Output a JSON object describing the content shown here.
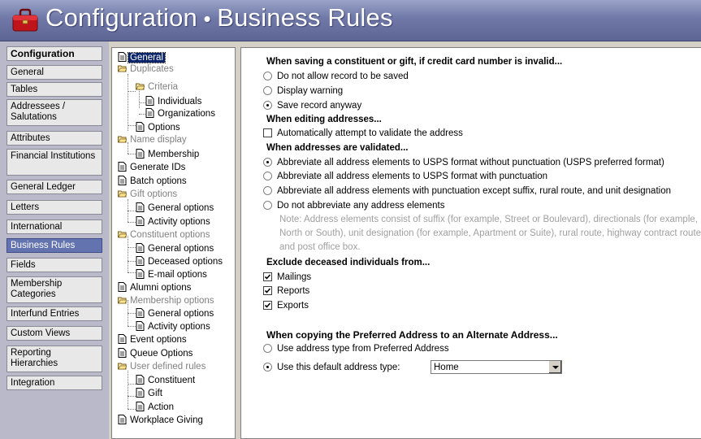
{
  "title": {
    "prefix": "Configuration",
    "separator": "•",
    "suffix": "Business Rules",
    "icon": "toolbox-icon"
  },
  "nav": {
    "header": "Configuration",
    "items": [
      {
        "label": "General"
      },
      {
        "label": "Tables"
      },
      {
        "label": "Addressees / Salutations"
      },
      {
        "label": "Attributes"
      },
      {
        "label": "Financial Institutions"
      },
      {
        "label": "General Ledger"
      },
      {
        "label": "Letters"
      },
      {
        "label": "International"
      },
      {
        "label": "Business Rules"
      },
      {
        "label": "Fields"
      },
      {
        "label": "Membership Categories"
      },
      {
        "label": "Interfund Entries"
      },
      {
        "label": "Custom Views"
      },
      {
        "label": "Reporting Hierarchies"
      },
      {
        "label": "Integration"
      }
    ],
    "selected": "Business Rules"
  },
  "tree": [
    {
      "label": "General"
    },
    {
      "label": "Duplicates"
    },
    {
      "label": "Criteria"
    },
    {
      "label": "Individuals"
    },
    {
      "label": "Organizations"
    },
    {
      "label": "Options"
    },
    {
      "label": "Name display"
    },
    {
      "label": "Membership"
    },
    {
      "label": "Generate IDs"
    },
    {
      "label": "Batch options"
    },
    {
      "label": "Gift options"
    },
    {
      "label": "General options"
    },
    {
      "label": "Activity options"
    },
    {
      "label": "Constituent options"
    },
    {
      "label": "General options"
    },
    {
      "label": "Deceased options"
    },
    {
      "label": "E-mail options"
    },
    {
      "label": "Alumni options"
    },
    {
      "label": "Membership options"
    },
    {
      "label": "General options"
    },
    {
      "label": "Activity options"
    },
    {
      "label": "Event options"
    },
    {
      "label": "Queue Options"
    },
    {
      "label": "User defined rules"
    },
    {
      "label": "Constituent"
    },
    {
      "label": "Gift"
    },
    {
      "label": "Action"
    },
    {
      "label": "Workplace Giving"
    }
  ],
  "main": {
    "cc_header": "When saving a constituent or gift, if credit card number is invalid...",
    "cc_options": [
      "Do not allow record to be saved",
      "Display warning",
      "Save record anyway"
    ],
    "edit_header": "When editing addresses...",
    "edit_check": "Automatically attempt to validate the address",
    "validated_header": "When addresses are validated...",
    "validated_options": [
      "Abbreviate all address elements to USPS format without punctuation (USPS preferred format)",
      "Abbreviate all address elements to USPS format with punctuation",
      "Abbreviate all address elements with punctuation except suffix, rural route, and unit designation",
      "Do not abbreviate any address elements"
    ],
    "note_lines": [
      "Note:  Address elements consist of suffix (for example, Street or Boulevard), directionals (for example,",
      "North or South), unit designation (for example, Apartment or Suite), rural route, highway contract route,",
      "and post office box."
    ],
    "exclude_header": "Exclude deceased individuals from...",
    "exclude_options": [
      "Mailings",
      "Reports",
      "Exports"
    ],
    "copy_header": "When copying the Preferred Address to an Alternate Address...",
    "copy_options": [
      "Use address type from Preferred Address",
      "Use this default address type:"
    ],
    "default_address_type": "Home"
  }
}
